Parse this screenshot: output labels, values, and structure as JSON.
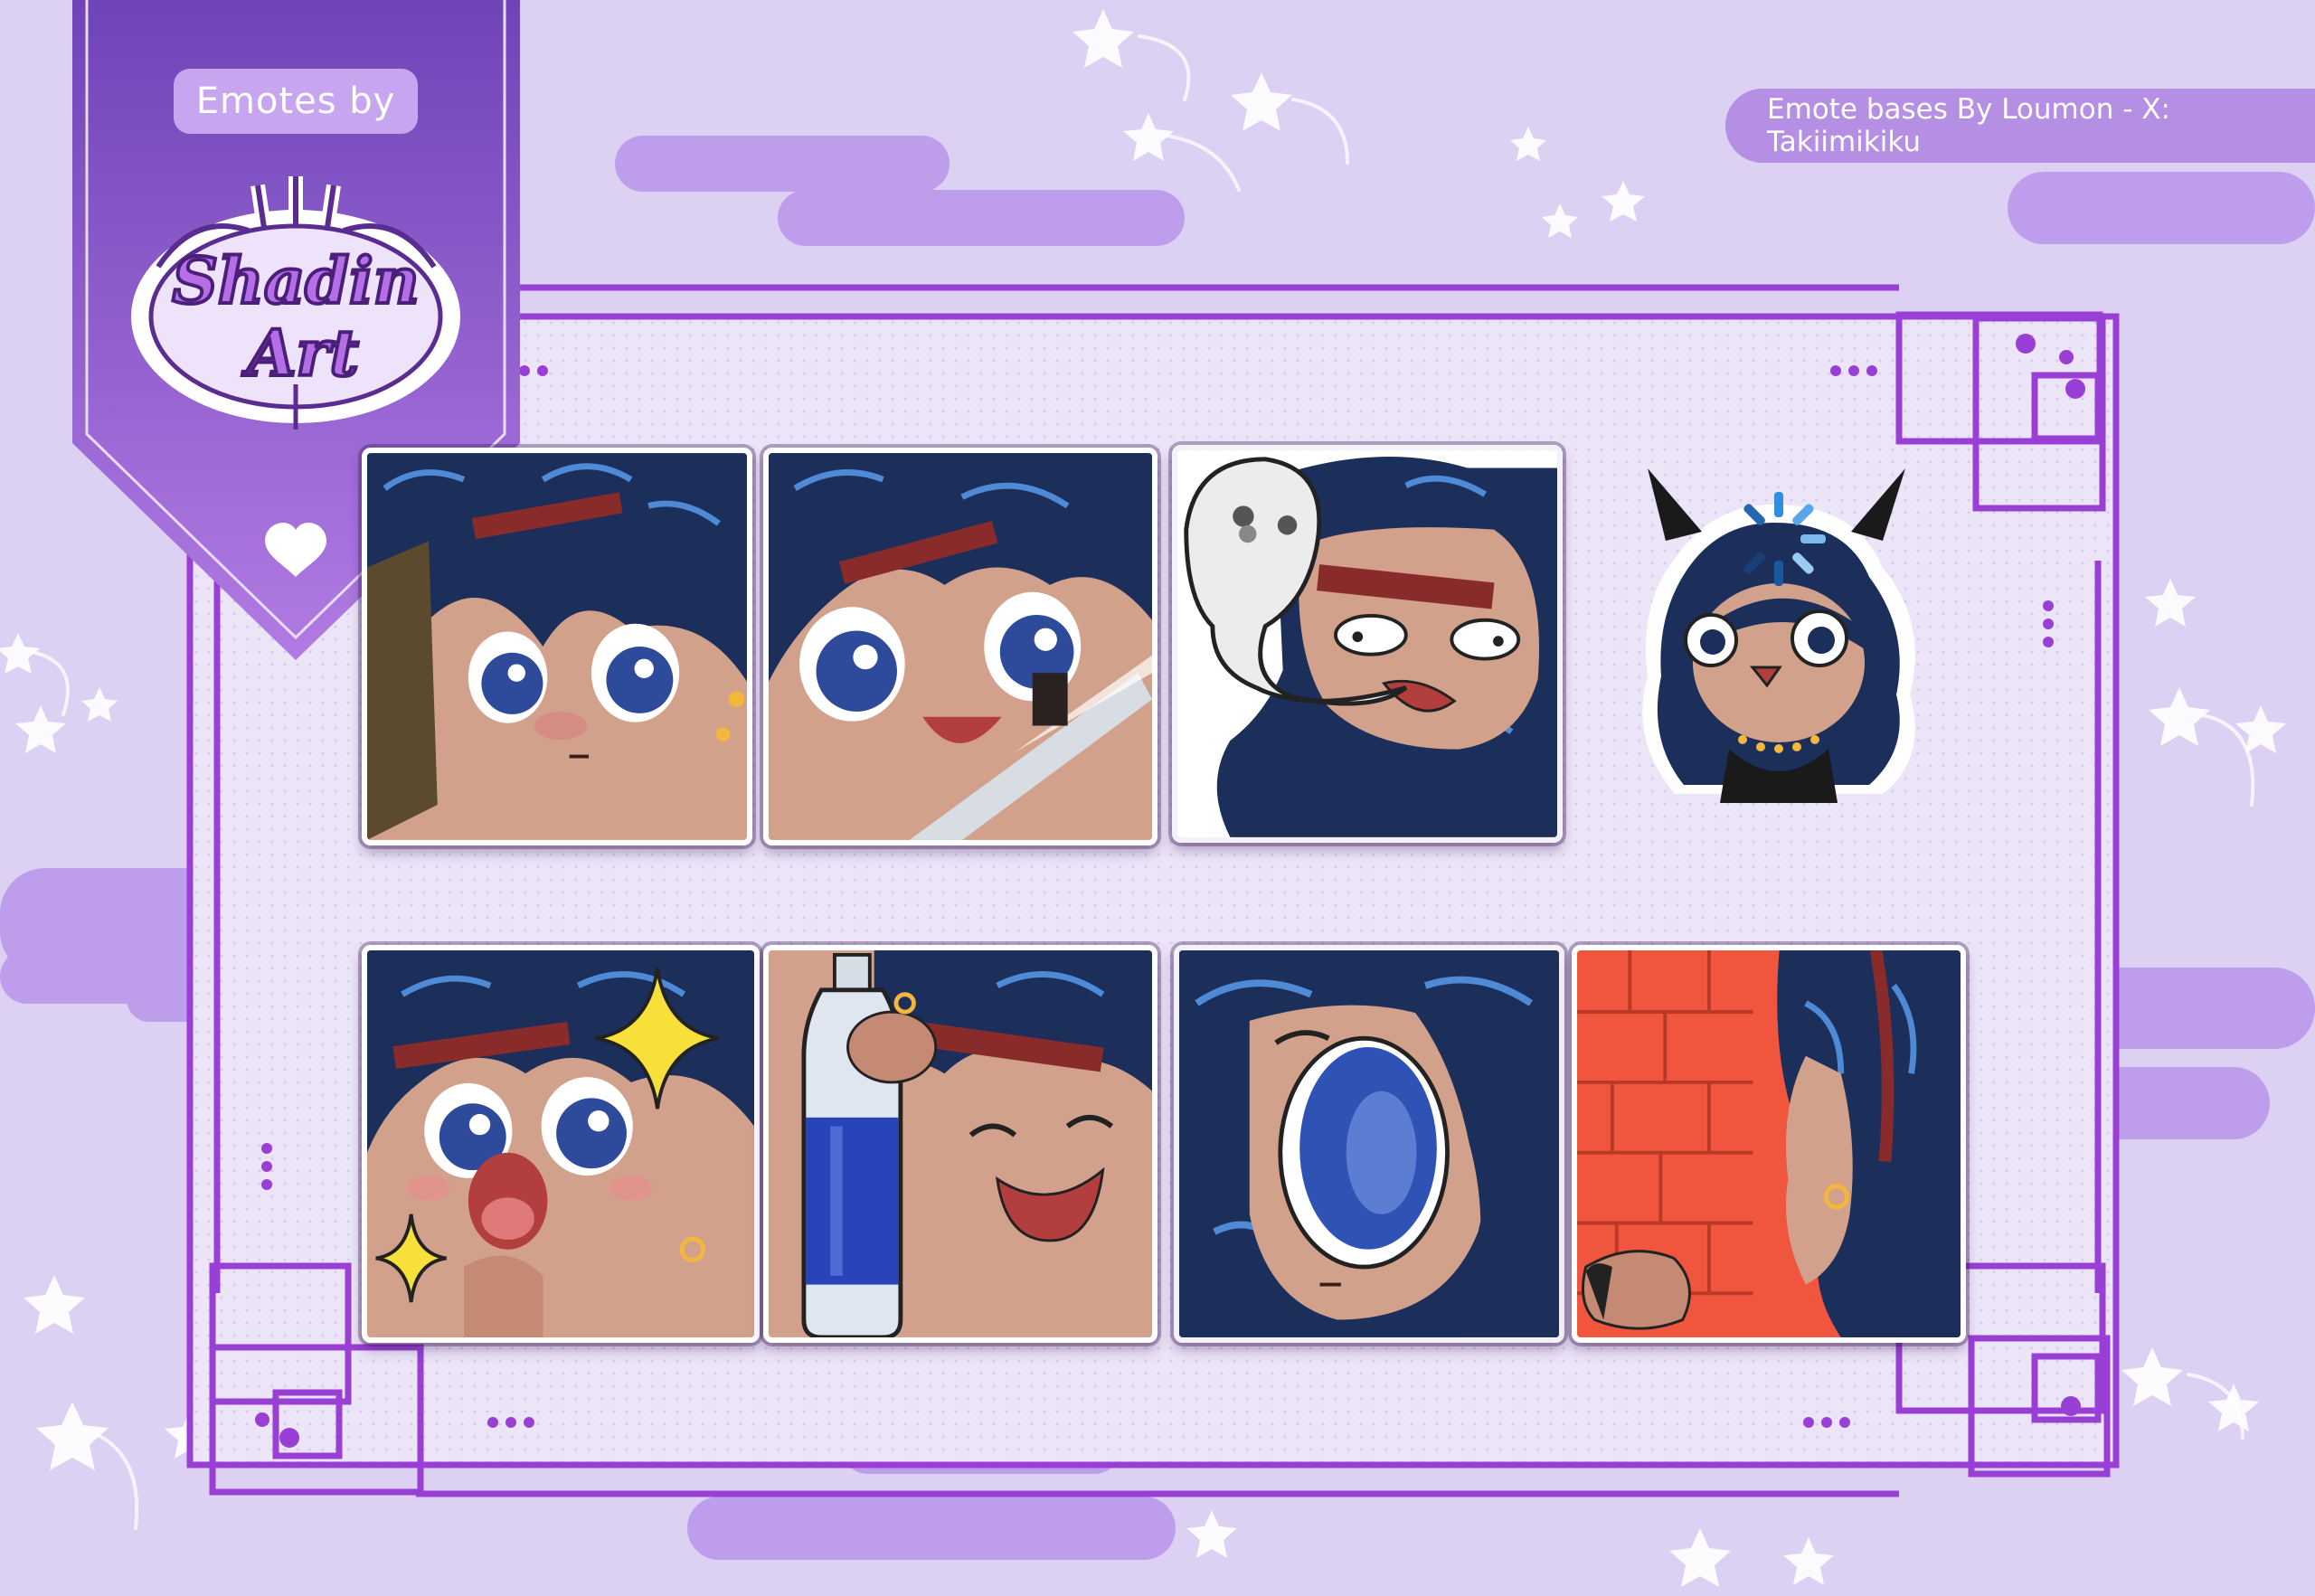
{
  "header": {
    "emotes_by_label": "Emotes by",
    "brand_logo_text": "Shadin Art",
    "credit_text": "Emote bases By Loumon - X: Takiimikiku"
  },
  "colors": {
    "background": "#dcd0f3",
    "banner_purple": "#8a57d1",
    "frame_purple": "#9a3fd6",
    "cloud": "#b995ea",
    "hair_navy": "#1c2f5a",
    "skin": "#d9a28a",
    "brick_red": "#f0553e"
  },
  "emotes": [
    {
      "id": "emote-1",
      "depicts": "peeking-behind-door-icon"
    },
    {
      "id": "emote-2",
      "depicts": "knife-smile-icon"
    },
    {
      "id": "emote-3",
      "depicts": "ghost-soul-leaving-icon"
    },
    {
      "id": "emote-4",
      "depicts": "loading-chibi-icon"
    },
    {
      "id": "emote-5",
      "depicts": "sparkle-excited-icon"
    },
    {
      "id": "emote-6",
      "depicts": "water-bottle-icon"
    },
    {
      "id": "emote-7",
      "depicts": "blank-stare-icon"
    },
    {
      "id": "emote-8",
      "depicts": "facing-brick-wall-icon"
    }
  ]
}
